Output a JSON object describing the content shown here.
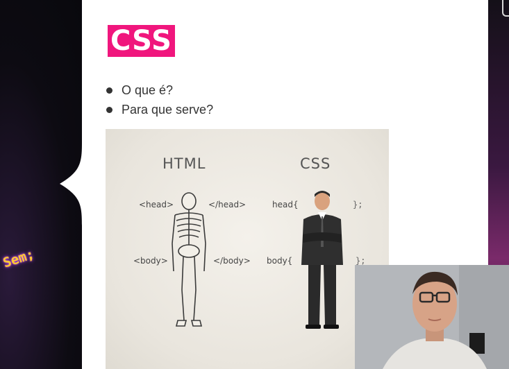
{
  "background": {
    "code_word": "Sem;"
  },
  "slide": {
    "title": "CSS",
    "bullets": [
      "O que é?",
      "Para que serve?"
    ],
    "figure": {
      "html_heading": "HTML",
      "css_heading": "CSS",
      "html_tag_head_open": "<head>",
      "html_tag_head_close": "</head>",
      "html_tag_body_open": "<body>",
      "html_tag_body_close": "</body>",
      "css_head_selector": "head{",
      "css_head_close": "};",
      "css_body_selector": "body{",
      "css_body_close": "};"
    }
  },
  "colors": {
    "title_badge": "#f0167d",
    "slide_bg": "#ffffff",
    "page_bg": "#0b0b10"
  },
  "icons": [
    "skeleton-illustration",
    "businessman-illustration",
    "webcam-presenter"
  ]
}
